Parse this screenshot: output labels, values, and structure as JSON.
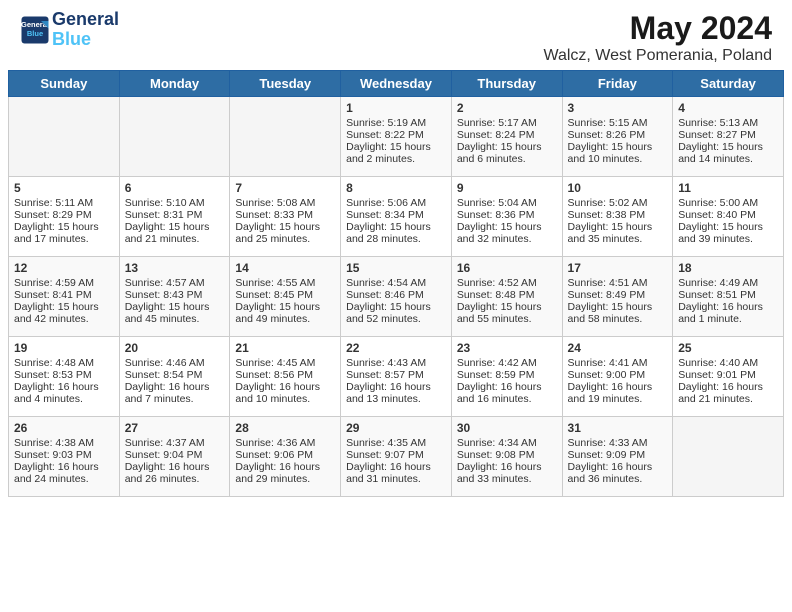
{
  "header": {
    "logo_line1": "General",
    "logo_line2": "Blue",
    "month": "May 2024",
    "location": "Walcz, West Pomerania, Poland"
  },
  "days_of_week": [
    "Sunday",
    "Monday",
    "Tuesday",
    "Wednesday",
    "Thursday",
    "Friday",
    "Saturday"
  ],
  "weeks": [
    [
      {
        "day": "",
        "content": ""
      },
      {
        "day": "",
        "content": ""
      },
      {
        "day": "",
        "content": ""
      },
      {
        "day": "1",
        "content": "Sunrise: 5:19 AM\nSunset: 8:22 PM\nDaylight: 15 hours and 2 minutes."
      },
      {
        "day": "2",
        "content": "Sunrise: 5:17 AM\nSunset: 8:24 PM\nDaylight: 15 hours and 6 minutes."
      },
      {
        "day": "3",
        "content": "Sunrise: 5:15 AM\nSunset: 8:26 PM\nDaylight: 15 hours and 10 minutes."
      },
      {
        "day": "4",
        "content": "Sunrise: 5:13 AM\nSunset: 8:27 PM\nDaylight: 15 hours and 14 minutes."
      }
    ],
    [
      {
        "day": "5",
        "content": "Sunrise: 5:11 AM\nSunset: 8:29 PM\nDaylight: 15 hours and 17 minutes."
      },
      {
        "day": "6",
        "content": "Sunrise: 5:10 AM\nSunset: 8:31 PM\nDaylight: 15 hours and 21 minutes."
      },
      {
        "day": "7",
        "content": "Sunrise: 5:08 AM\nSunset: 8:33 PM\nDaylight: 15 hours and 25 minutes."
      },
      {
        "day": "8",
        "content": "Sunrise: 5:06 AM\nSunset: 8:34 PM\nDaylight: 15 hours and 28 minutes."
      },
      {
        "day": "9",
        "content": "Sunrise: 5:04 AM\nSunset: 8:36 PM\nDaylight: 15 hours and 32 minutes."
      },
      {
        "day": "10",
        "content": "Sunrise: 5:02 AM\nSunset: 8:38 PM\nDaylight: 15 hours and 35 minutes."
      },
      {
        "day": "11",
        "content": "Sunrise: 5:00 AM\nSunset: 8:40 PM\nDaylight: 15 hours and 39 minutes."
      }
    ],
    [
      {
        "day": "12",
        "content": "Sunrise: 4:59 AM\nSunset: 8:41 PM\nDaylight: 15 hours and 42 minutes."
      },
      {
        "day": "13",
        "content": "Sunrise: 4:57 AM\nSunset: 8:43 PM\nDaylight: 15 hours and 45 minutes."
      },
      {
        "day": "14",
        "content": "Sunrise: 4:55 AM\nSunset: 8:45 PM\nDaylight: 15 hours and 49 minutes."
      },
      {
        "day": "15",
        "content": "Sunrise: 4:54 AM\nSunset: 8:46 PM\nDaylight: 15 hours and 52 minutes."
      },
      {
        "day": "16",
        "content": "Sunrise: 4:52 AM\nSunset: 8:48 PM\nDaylight: 15 hours and 55 minutes."
      },
      {
        "day": "17",
        "content": "Sunrise: 4:51 AM\nSunset: 8:49 PM\nDaylight: 15 hours and 58 minutes."
      },
      {
        "day": "18",
        "content": "Sunrise: 4:49 AM\nSunset: 8:51 PM\nDaylight: 16 hours and 1 minute."
      }
    ],
    [
      {
        "day": "19",
        "content": "Sunrise: 4:48 AM\nSunset: 8:53 PM\nDaylight: 16 hours and 4 minutes."
      },
      {
        "day": "20",
        "content": "Sunrise: 4:46 AM\nSunset: 8:54 PM\nDaylight: 16 hours and 7 minutes."
      },
      {
        "day": "21",
        "content": "Sunrise: 4:45 AM\nSunset: 8:56 PM\nDaylight: 16 hours and 10 minutes."
      },
      {
        "day": "22",
        "content": "Sunrise: 4:43 AM\nSunset: 8:57 PM\nDaylight: 16 hours and 13 minutes."
      },
      {
        "day": "23",
        "content": "Sunrise: 4:42 AM\nSunset: 8:59 PM\nDaylight: 16 hours and 16 minutes."
      },
      {
        "day": "24",
        "content": "Sunrise: 4:41 AM\nSunset: 9:00 PM\nDaylight: 16 hours and 19 minutes."
      },
      {
        "day": "25",
        "content": "Sunrise: 4:40 AM\nSunset: 9:01 PM\nDaylight: 16 hours and 21 minutes."
      }
    ],
    [
      {
        "day": "26",
        "content": "Sunrise: 4:38 AM\nSunset: 9:03 PM\nDaylight: 16 hours and 24 minutes."
      },
      {
        "day": "27",
        "content": "Sunrise: 4:37 AM\nSunset: 9:04 PM\nDaylight: 16 hours and 26 minutes."
      },
      {
        "day": "28",
        "content": "Sunrise: 4:36 AM\nSunset: 9:06 PM\nDaylight: 16 hours and 29 minutes."
      },
      {
        "day": "29",
        "content": "Sunrise: 4:35 AM\nSunset: 9:07 PM\nDaylight: 16 hours and 31 minutes."
      },
      {
        "day": "30",
        "content": "Sunrise: 4:34 AM\nSunset: 9:08 PM\nDaylight: 16 hours and 33 minutes."
      },
      {
        "day": "31",
        "content": "Sunrise: 4:33 AM\nSunset: 9:09 PM\nDaylight: 16 hours and 36 minutes."
      },
      {
        "day": "",
        "content": ""
      }
    ]
  ]
}
